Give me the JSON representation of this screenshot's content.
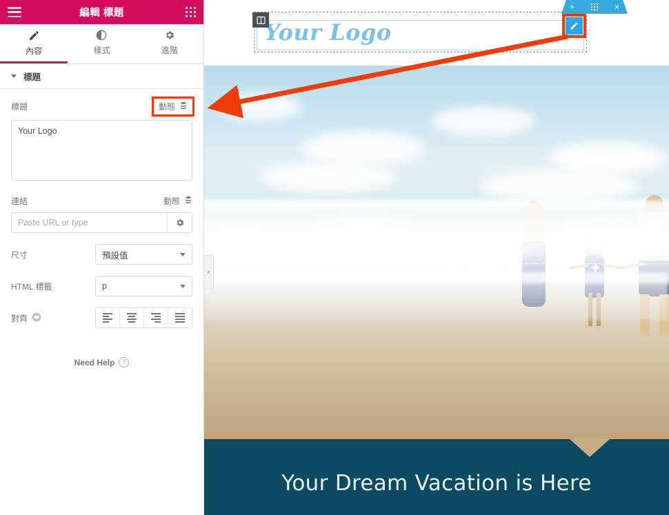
{
  "panel": {
    "header": {
      "title": "編輯 標題",
      "menu_icon": "hamburger-icon",
      "apps_icon": "apps-grid-icon"
    },
    "tabs": [
      {
        "label": "內容",
        "icon": "pencil-icon",
        "active": true
      },
      {
        "label": "樣式",
        "icon": "contrast-circle-icon",
        "active": false
      },
      {
        "label": "進階",
        "icon": "gear-icon",
        "active": false
      }
    ],
    "section": {
      "label": "標題",
      "collapsed": false
    },
    "controls": {
      "title": {
        "label": "標題",
        "dynamic_label": "動態",
        "dynamic_icon": "database-icon",
        "highlighted": true,
        "value": "Your Logo"
      },
      "link": {
        "label": "連結",
        "dynamic_label": "動態",
        "dynamic_icon": "database-icon",
        "value": "",
        "placeholder": "Paste URL or type",
        "options_icon": "gear-icon"
      },
      "size": {
        "label": "尺寸",
        "value": "預設值"
      },
      "html_tag": {
        "label": "HTML 標籤",
        "value": "p"
      },
      "align": {
        "label": "對齊",
        "device_icon": "responsive-device-icon",
        "options": [
          "左",
          "置中",
          "右",
          "左右對齊"
        ],
        "selected": ""
      }
    },
    "need_help": {
      "label": "Need Help",
      "icon": "question-circle-icon"
    }
  },
  "canvas": {
    "section_toolbar": {
      "add_icon": "plus-icon",
      "drag_icon": "drag-grid-icon",
      "close_icon": "close-icon"
    },
    "column_handle_icon": "column-layout-icon",
    "edit_widget_button": {
      "icon": "pencil-icon",
      "highlighted": true
    },
    "logo_text": "Your Logo",
    "panel_toggle_icon": "chevron-left-icon",
    "hero_alt": "family-holding-hands-at-beach",
    "banner_text": "Your Dream Vacation is Here"
  },
  "annotation": {
    "arrow": "red-arrow-from-edit-button-to-dynamic-button",
    "color": "#f03c0a"
  },
  "colors": {
    "brand_pink": "#d30c5c",
    "accent_blue": "#2fa4e7",
    "highlight_red": "#f03c0a",
    "banner_teal": "#0b4a60",
    "logo_blue": "#7dc0e0"
  }
}
